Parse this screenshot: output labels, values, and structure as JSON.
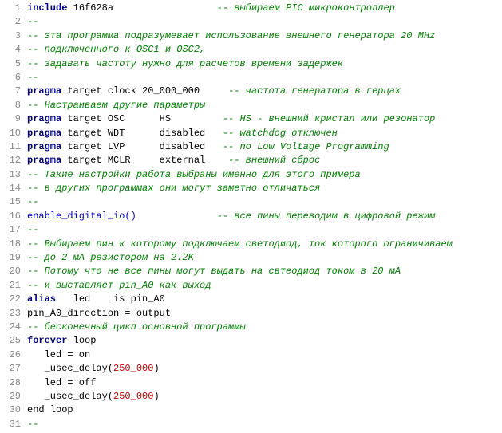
{
  "lines": [
    {
      "num": 1,
      "parts": [
        {
          "text": "include",
          "cls": "kw"
        },
        {
          "text": " 16f628a                  ",
          "cls": "plain"
        },
        {
          "text": "-- выбираем PIC микроконтроллер",
          "cls": "comment"
        }
      ]
    },
    {
      "num": 2,
      "parts": [
        {
          "text": "--",
          "cls": "comment"
        }
      ]
    },
    {
      "num": 3,
      "parts": [
        {
          "text": "-- эта программа подразумевает использование внешнего генератора 20 MHz",
          "cls": "comment"
        }
      ]
    },
    {
      "num": 4,
      "parts": [
        {
          "text": "-- подключенного к OSC1 и OSC2,",
          "cls": "comment"
        }
      ]
    },
    {
      "num": 5,
      "parts": [
        {
          "text": "-- задавать частоту нужно для расчетов времени задержек",
          "cls": "comment"
        }
      ]
    },
    {
      "num": 6,
      "parts": [
        {
          "text": "--",
          "cls": "comment"
        }
      ]
    },
    {
      "num": 7,
      "parts": [
        {
          "text": "pragma",
          "cls": "kw"
        },
        {
          "text": " target ",
          "cls": "plain"
        },
        {
          "text": "clock",
          "cls": "plain"
        },
        {
          "text": " 20_000_000     ",
          "cls": "plain"
        },
        {
          "text": "-- частота генератора в герцах",
          "cls": "comment"
        }
      ]
    },
    {
      "num": 8,
      "parts": [
        {
          "text": "-- Настраиваем другие параметры",
          "cls": "comment"
        }
      ]
    },
    {
      "num": 9,
      "parts": [
        {
          "text": "pragma",
          "cls": "kw"
        },
        {
          "text": " target ",
          "cls": "plain"
        },
        {
          "text": "OSC",
          "cls": "plain"
        },
        {
          "text": "      HS         ",
          "cls": "plain"
        },
        {
          "text": "-- HS - внешний кристал или резонатор",
          "cls": "comment"
        }
      ]
    },
    {
      "num": 10,
      "parts": [
        {
          "text": "pragma",
          "cls": "kw"
        },
        {
          "text": " target ",
          "cls": "plain"
        },
        {
          "text": "WDT",
          "cls": "plain"
        },
        {
          "text": "      disabled   ",
          "cls": "plain"
        },
        {
          "text": "-- watchdog отключен",
          "cls": "comment"
        }
      ]
    },
    {
      "num": 11,
      "parts": [
        {
          "text": "pragma",
          "cls": "kw"
        },
        {
          "text": " target ",
          "cls": "plain"
        },
        {
          "text": "LVP",
          "cls": "plain"
        },
        {
          "text": "      disabled   ",
          "cls": "plain"
        },
        {
          "text": "-- no Low Voltage Programming",
          "cls": "comment"
        }
      ]
    },
    {
      "num": 12,
      "parts": [
        {
          "text": "pragma",
          "cls": "kw"
        },
        {
          "text": " target ",
          "cls": "plain"
        },
        {
          "text": "MCLR",
          "cls": "plain"
        },
        {
          "text": "     external    ",
          "cls": "plain"
        },
        {
          "text": "-- внешний сброс",
          "cls": "comment"
        }
      ]
    },
    {
      "num": 13,
      "parts": [
        {
          "text": "-- Такие настройки работа выбраны именно для этого примера",
          "cls": "comment"
        }
      ]
    },
    {
      "num": 14,
      "parts": [
        {
          "text": "-- в других программах они могут заметно отличаться",
          "cls": "comment"
        }
      ]
    },
    {
      "num": 15,
      "parts": [
        {
          "text": "--",
          "cls": "comment"
        }
      ]
    },
    {
      "num": 16,
      "parts": [
        {
          "text": "enable_digital_io()",
          "cls": "fn"
        },
        {
          "text": "              ",
          "cls": "plain"
        },
        {
          "text": "-- все пины переводим в цифровой режим",
          "cls": "comment"
        }
      ]
    },
    {
      "num": 17,
      "parts": [
        {
          "text": "--",
          "cls": "comment"
        }
      ]
    },
    {
      "num": 18,
      "parts": [
        {
          "text": "-- Выбираем пин к которому подключаем светодиод, ток которого ограничиваем",
          "cls": "comment"
        }
      ]
    },
    {
      "num": 19,
      "parts": [
        {
          "text": "-- до 2 мА резистором на 2.2K",
          "cls": "comment"
        }
      ]
    },
    {
      "num": 20,
      "parts": [
        {
          "text": "-- Потому что не все пины могут выдать на свтеодиод током в 20 мА",
          "cls": "comment"
        }
      ]
    },
    {
      "num": 21,
      "parts": [
        {
          "text": "-- и выставляет pin_A0 как выход",
          "cls": "comment"
        }
      ]
    },
    {
      "num": 22,
      "parts": [
        {
          "text": "alias",
          "cls": "kw"
        },
        {
          "text": "   led    is pin_A0",
          "cls": "plain"
        }
      ]
    },
    {
      "num": 23,
      "parts": [
        {
          "text": "pin_A0_direction = output",
          "cls": "plain"
        }
      ]
    },
    {
      "num": 24,
      "parts": [
        {
          "text": "-- бесконечный цикл основной программы",
          "cls": "comment"
        }
      ]
    },
    {
      "num": 25,
      "parts": [
        {
          "text": "forever",
          "cls": "kw"
        },
        {
          "text": " loop",
          "cls": "plain"
        }
      ]
    },
    {
      "num": 26,
      "parts": [
        {
          "text": "   led = on",
          "cls": "plain"
        }
      ]
    },
    {
      "num": 27,
      "parts": [
        {
          "text": "   _usec_delay(250_000)",
          "cls": "plain"
        }
      ]
    },
    {
      "num": 28,
      "parts": [
        {
          "text": "   led = off",
          "cls": "plain"
        }
      ]
    },
    {
      "num": 29,
      "parts": [
        {
          "text": "   _usec_delay(250_000)",
          "cls": "plain"
        }
      ]
    },
    {
      "num": 30,
      "parts": [
        {
          "text": "end loop",
          "cls": "plain"
        }
      ]
    },
    {
      "num": 31,
      "parts": [
        {
          "text": "--",
          "cls": "comment"
        }
      ]
    }
  ]
}
